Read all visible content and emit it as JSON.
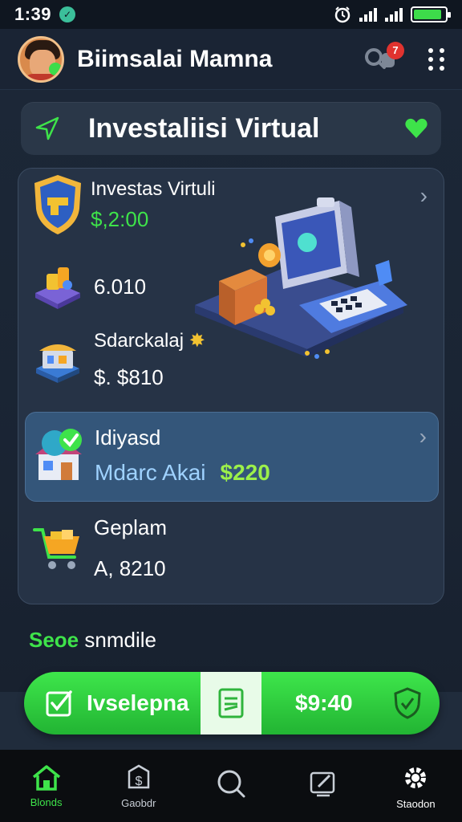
{
  "status_bar": {
    "time": "1:39"
  },
  "header": {
    "user_name": "Biimsalai Mamna",
    "notification_count": "7"
  },
  "title_bar": {
    "title": "Investaliisi Virtual"
  },
  "card": {
    "rows": [
      {
        "title": "Investas Virtuli",
        "value": "$,2:00",
        "icon": "shield-icon"
      },
      {
        "title": "",
        "value": "6.010",
        "icon": "coins-stack-icon"
      },
      {
        "title": "Sdarckalaj",
        "value": "$. $810",
        "icon": "shop-icon"
      }
    ],
    "highlight": {
      "title": "Idiyasd",
      "subtitle": "Mdarc Akai",
      "amount": "$220",
      "icon": "store-check-icon"
    },
    "last": {
      "title": "Geplam",
      "value": "A, 8210",
      "icon": "cart-icon"
    }
  },
  "summary": {
    "green_text": "Seoe",
    "text": "snmdile"
  },
  "cta": {
    "label": "Ivselepna",
    "amount": "$9:40"
  },
  "nav": [
    {
      "label": "Blonds",
      "icon": "home-icon",
      "active": true
    },
    {
      "label": "Gaobdr",
      "icon": "wallet-icon",
      "active": false
    },
    {
      "label": "",
      "icon": "search-icon",
      "active": false
    },
    {
      "label": "",
      "icon": "edit-icon",
      "active": false
    },
    {
      "label": "Staodon",
      "icon": "settings-icon",
      "active": false
    }
  ],
  "colors": {
    "accent": "#3ee34a",
    "card": "#263346",
    "highlight": "#34567a",
    "background": "#1c2838"
  }
}
